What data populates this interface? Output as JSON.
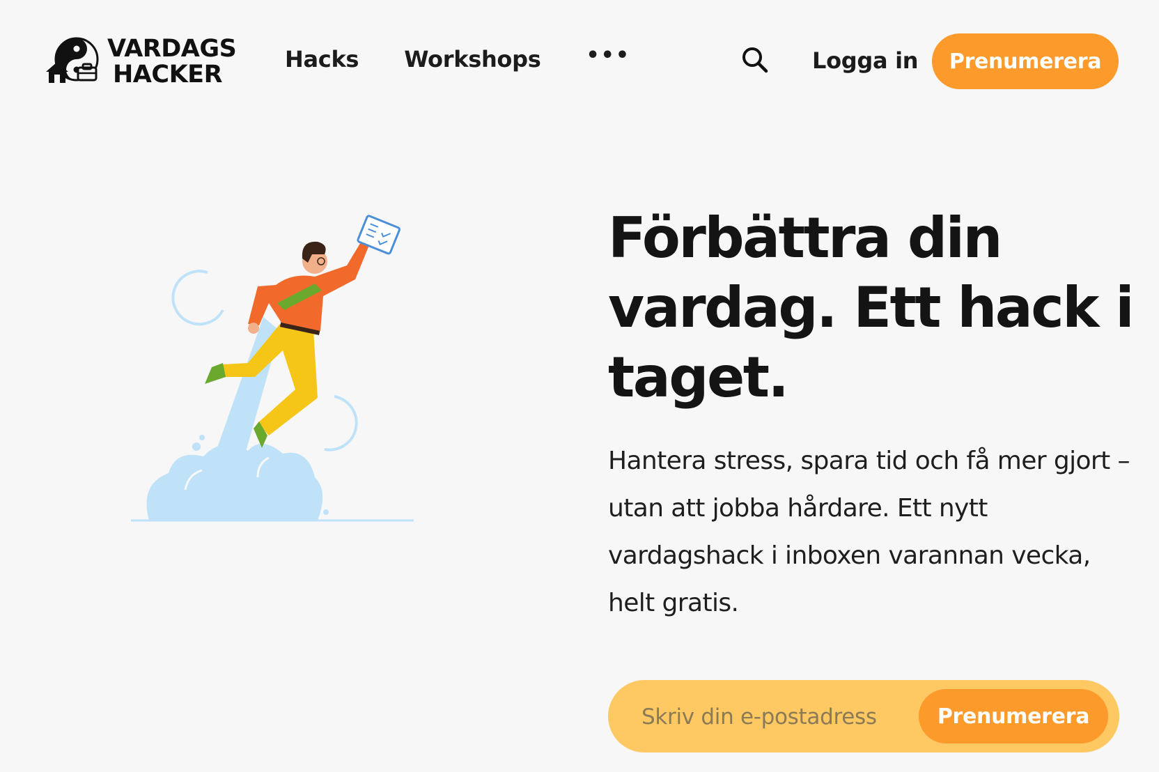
{
  "brand": {
    "name_line1": "VARDAGS",
    "name_line2": "HACKER",
    "logo_icon": "yin-yang-house-briefcase-icon"
  },
  "nav": {
    "items": [
      {
        "label": "Hacks"
      },
      {
        "label": "Workshops"
      }
    ],
    "more_label": "•••",
    "more_icon": "more-dots-icon",
    "search_icon": "search-icon",
    "login_label": "Logga in",
    "subscribe_label": "Prenumerera"
  },
  "hero": {
    "title": "Förbättra din vardag. Ett hack i taget.",
    "text": "Hantera stress, spara tid och få mer gjort – utan att jobba hårdare. Ett nytt vardagshack i inboxen varannan vecka, helt gratis.",
    "illustration": "man-flying-with-checklist-illustration"
  },
  "signup": {
    "email_placeholder": "Skriv din e-postadress",
    "email_value": "",
    "button_label": "Prenumerera"
  },
  "colors": {
    "background": "#f7f7f7",
    "accent_orange": "#fd9a2c",
    "form_yellow": "#fec862",
    "text_dark": "#141414",
    "illustration_blue": "#bfe2f8"
  }
}
